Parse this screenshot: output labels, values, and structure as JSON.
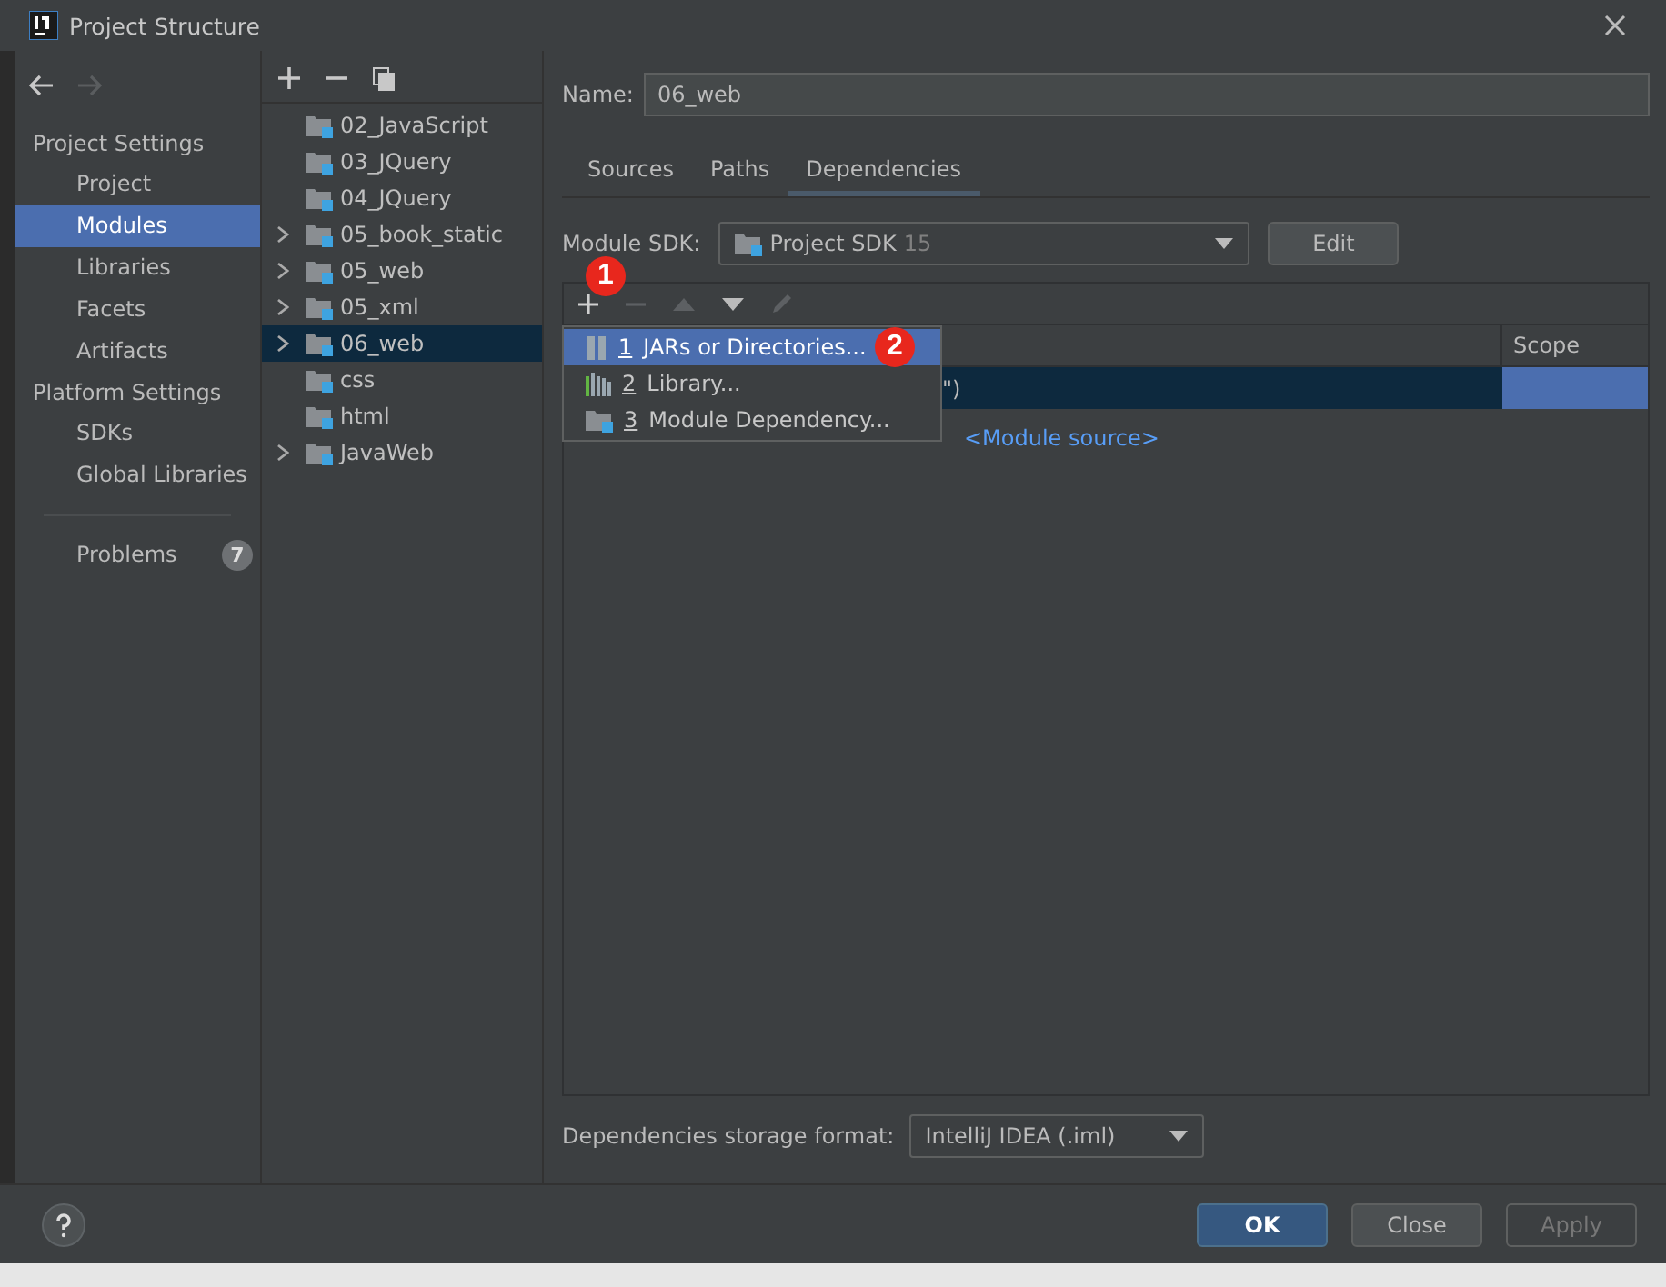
{
  "window": {
    "title": "Project Structure"
  },
  "nav": {
    "sections": [
      {
        "title": "Project Settings",
        "items": [
          {
            "label": "Project",
            "selected": false
          },
          {
            "label": "Modules",
            "selected": true
          },
          {
            "label": "Libraries",
            "selected": false
          },
          {
            "label": "Facets",
            "selected": false
          },
          {
            "label": "Artifacts",
            "selected": false
          }
        ]
      },
      {
        "title": "Platform Settings",
        "items": [
          {
            "label": "SDKs",
            "selected": false
          },
          {
            "label": "Global Libraries",
            "selected": false
          }
        ]
      }
    ],
    "problems": {
      "label": "Problems",
      "count": "7"
    }
  },
  "tree": {
    "items": [
      {
        "label": "02_JavaScript",
        "expandable": false,
        "selected": false
      },
      {
        "label": "03_JQuery",
        "expandable": false,
        "selected": false
      },
      {
        "label": "04_JQuery",
        "expandable": false,
        "selected": false
      },
      {
        "label": "05_book_static",
        "expandable": true,
        "selected": false
      },
      {
        "label": "05_web",
        "expandable": true,
        "selected": false
      },
      {
        "label": "05_xml",
        "expandable": true,
        "selected": false
      },
      {
        "label": "06_web",
        "expandable": true,
        "selected": true
      },
      {
        "label": "css",
        "expandable": false,
        "selected": false
      },
      {
        "label": "html",
        "expandable": false,
        "selected": false
      },
      {
        "label": "JavaWeb",
        "expandable": true,
        "selected": false
      }
    ]
  },
  "name_field": {
    "label": "Name:",
    "value": "06_web"
  },
  "tabs": [
    {
      "label": "Sources",
      "selected": false
    },
    {
      "label": "Paths",
      "selected": false
    },
    {
      "label": "Dependencies",
      "selected": true
    }
  ],
  "module_sdk": {
    "label": "Module SDK:",
    "value": "Project SDK",
    "version": "15",
    "button": "Edit"
  },
  "table": {
    "columns": [
      "Scope"
    ],
    "rows": [
      {
        "text": "\")",
        "selected": true
      },
      {
        "text": "<Module source>",
        "selected": false
      }
    ]
  },
  "popup": {
    "items": [
      {
        "number": "1",
        "label": "JARs or Directories...",
        "kind": "jars",
        "selected": true
      },
      {
        "number": "2",
        "label": "Library...",
        "kind": "library",
        "selected": false
      },
      {
        "number": "3",
        "label": "Module Dependency...",
        "kind": "module",
        "selected": false
      }
    ]
  },
  "step_badges": [
    "1",
    "2"
  ],
  "storage_format": {
    "label": "Dependencies storage format:",
    "value": "IntelliJ IDEA (.iml)"
  },
  "buttons": [
    {
      "label": "OK",
      "kind": "primary",
      "disabled": false
    },
    {
      "label": "Close",
      "kind": "normal",
      "disabled": false
    },
    {
      "label": "Apply",
      "kind": "normal",
      "disabled": true
    }
  ]
}
